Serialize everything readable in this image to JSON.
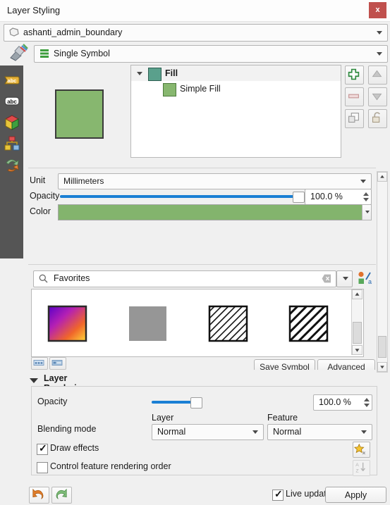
{
  "window": {
    "title": "Layer Styling",
    "close_label": "x"
  },
  "layer_selector": {
    "value": "ashanti_admin_boundary",
    "icon": "polygon-layer-icon"
  },
  "renderer_selector": {
    "value": "Single Symbol",
    "icon": "single-symbol-icon",
    "brush_icon": "paintbrush-icon"
  },
  "sidebar": {
    "items": [
      {
        "name": "labels",
        "icon": "label-tag-icon"
      },
      {
        "name": "masks",
        "icon": "abc-callout-icon"
      },
      {
        "name": "3d-view",
        "icon": "cube-3d-icon"
      },
      {
        "name": "diagrams",
        "icon": "diagram-icon"
      },
      {
        "name": "actions",
        "icon": "actions-arrows-icon"
      }
    ]
  },
  "symbol_tree": {
    "rows": [
      {
        "label": "Fill",
        "swatch": "#5aa08c",
        "level": 0,
        "selected": true,
        "expanded": true
      },
      {
        "label": "Simple Fill",
        "swatch": "#87b76f",
        "level": 1,
        "selected": false
      }
    ]
  },
  "layer_buttons": [
    {
      "name": "add-symbol-layer",
      "icon": "plus-icon",
      "enabled": true
    },
    {
      "name": "move-symbol-layer-up",
      "icon": "arrow-up-icon",
      "enabled": false
    },
    {
      "name": "remove-symbol-layer",
      "icon": "minus-icon",
      "enabled": false
    },
    {
      "name": "move-symbol-layer-down",
      "icon": "arrow-down-icon",
      "enabled": false
    },
    {
      "name": "duplicate-symbol-layer",
      "icon": "copy-icon",
      "enabled": false
    },
    {
      "name": "lock-symbol-layer",
      "icon": "unlock-icon",
      "enabled": false
    }
  ],
  "symbol_properties": {
    "unit_label": "Unit",
    "unit_value": "Millimeters",
    "opacity_label": "Opacity",
    "opacity_value": "100.0 %",
    "opacity_percent": 100,
    "color_label": "Color",
    "color_value": "#83b46d",
    "preview_color": "#87b76f"
  },
  "search": {
    "value": "Favorites",
    "icon": "search-icon",
    "clear_icon": "clear-icon",
    "dropdown_icon": "chevron-down-icon",
    "style_manager_icon": "style-manager-icon"
  },
  "gallery": {
    "thumbnails": [
      {
        "name": "gradient-fill-symbol",
        "style": "gradient"
      },
      {
        "name": "gray-fill-symbol",
        "style": "gray"
      },
      {
        "name": "hatch-thin-symbol",
        "style": "hatch-thin"
      },
      {
        "name": "hatch-thick-symbol",
        "style": "hatch-thick"
      }
    ],
    "view_toggles": [
      {
        "name": "icon-view-toggle",
        "icon": "grid-view-icon"
      },
      {
        "name": "list-view-toggle",
        "icon": "list-view-icon"
      }
    ],
    "save_symbol_label": "Save Symbol",
    "advanced_label": "Advanced"
  },
  "layer_rendering": {
    "section_title": "Layer Rendering",
    "opacity_label": "Opacity",
    "opacity_value": "100.0 %",
    "opacity_percent": 100,
    "blending_label": "Blending mode",
    "layer_header": "Layer",
    "layer_value": "Normal",
    "feature_header": "Feature",
    "feature_value": "Normal",
    "draw_effects_label": "Draw effects",
    "draw_effects_checked": true,
    "control_order_label": "Control feature rendering order",
    "control_order_checked": false,
    "effects_button_icon": "star-effects-icon",
    "order_button_icon": "sort-az-icon"
  },
  "bottom_bar": {
    "undo_icon": "undo-arrow-icon",
    "redo_icon": "redo-arrow-icon",
    "live_update_label": "Live update",
    "live_update_checked": true,
    "apply_label": "Apply"
  }
}
